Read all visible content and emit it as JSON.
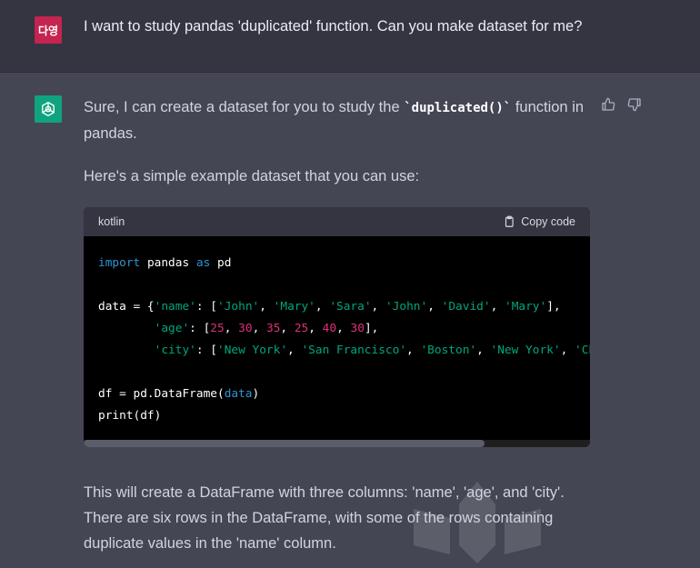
{
  "user_message": {
    "avatar_label": "다영",
    "text": "I want to study pandas 'duplicated' function. Can you make dataset for me?"
  },
  "assistant_message": {
    "para1_before": "Sure, I can create a dataset for you to study the ",
    "para1_code": "`duplicated()`",
    "para1_after": " function in",
    "para1_line2": "pandas.",
    "para2": "Here's a simple example dataset that you can use:",
    "code_block": {
      "language": "kotlin",
      "copy_label": "Copy code"
    },
    "para3_line1": "This will create a DataFrame with three columns: 'name', 'age', and 'city'.",
    "para3_line2": "There are six rows in the DataFrame, with some of the rows containing",
    "para3_line3": "duplicate values in the 'name' column."
  },
  "code": {
    "l1_import": "import",
    "l1_mod": " pandas ",
    "l1_as": "as",
    "l1_pd": " pd",
    "l3_var": "data = {",
    "key_name": "'name'",
    "colon_bracket": ": [",
    "names": [
      "'John'",
      "'Mary'",
      "'Sara'",
      "'John'",
      "'David'",
      "'Mary'"
    ],
    "key_age": "'age'",
    "ages": [
      "25",
      "30",
      "35",
      "25",
      "40",
      "30"
    ],
    "key_city": "'city'",
    "cities": [
      "'New York'",
      "'San Francisco'",
      "'Boston'",
      "'New York'",
      "'Chicago'"
    ],
    "l7_a": "df = pd.DataFrame(",
    "l7_data": "data",
    "l7_b": ")",
    "l8": "print(df)"
  },
  "watermark_text": "AIPRM",
  "colors": {
    "user_bg": "#343541",
    "assistant_bg": "#444654",
    "bot_avatar": "#10a37f",
    "user_avatar": "#c4244f"
  }
}
